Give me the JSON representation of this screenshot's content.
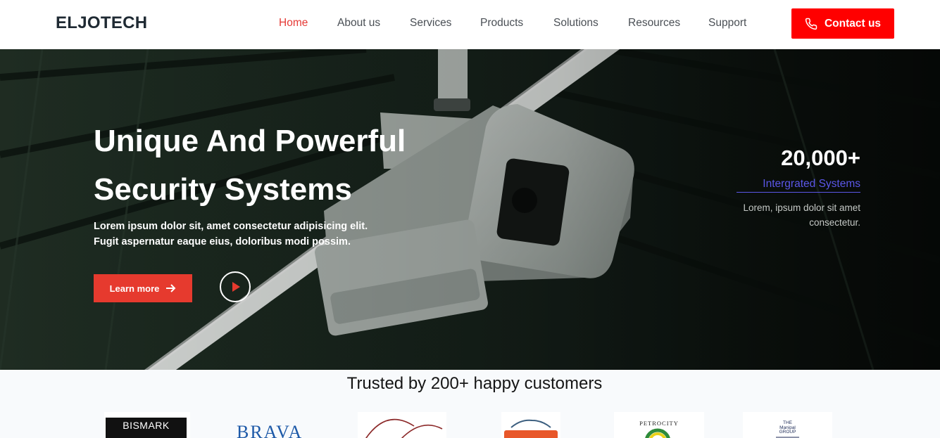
{
  "nav": {
    "brand": "ELJOTECH",
    "items": [
      {
        "label": "Home",
        "active": true
      },
      {
        "label": "About us",
        "active": false
      },
      {
        "label": "Services",
        "active": false
      },
      {
        "label": "Products",
        "active": false
      },
      {
        "label": "Solutions",
        "active": false
      },
      {
        "label": "Resources",
        "active": false
      },
      {
        "label": "Support",
        "active": false
      }
    ],
    "contact_label": "Contact us",
    "contact_icon": "phone-icon"
  },
  "hero": {
    "title_line1": "Unique And Powerful",
    "title_line2": "Security Systems",
    "subtitle_line1": "Lorem ipsum dolor sit, amet consectetur adipisicing elit.",
    "subtitle_line2": "Fugit aspernatur eaque eius, doloribus modi possim.",
    "learn_more_label": "Learn more",
    "learn_more_icon": "arrow-right-icon",
    "play_icon": "play-icon",
    "stat": {
      "number": "20,000+",
      "label": "Intergrated Systems",
      "description_line1": "Lorem, ipsum dolor sit amet",
      "description_line2": "consectetur."
    }
  },
  "trust": {
    "title": "Trusted by 200+ happy customers",
    "logos": [
      {
        "name": "bismark-logo",
        "text": "BISMARK"
      },
      {
        "name": "brava-logo",
        "text": "BRAVA"
      },
      {
        "name": "arcs-logo",
        "text": ""
      },
      {
        "name": "drove-logo",
        "text": ""
      },
      {
        "name": "petrocity-logo",
        "text": "PETROCITY"
      },
      {
        "name": "manipal-logo",
        "text_line1": "THE",
        "text_line2": "Manipal",
        "text_line3": "GROUP"
      }
    ]
  },
  "colors": {
    "accent": "#ff0000",
    "active_nav": "#e53935",
    "learn_button": "#e63a2e",
    "stat_label": "#5b57e8",
    "brand_text": "#1f2a33"
  }
}
